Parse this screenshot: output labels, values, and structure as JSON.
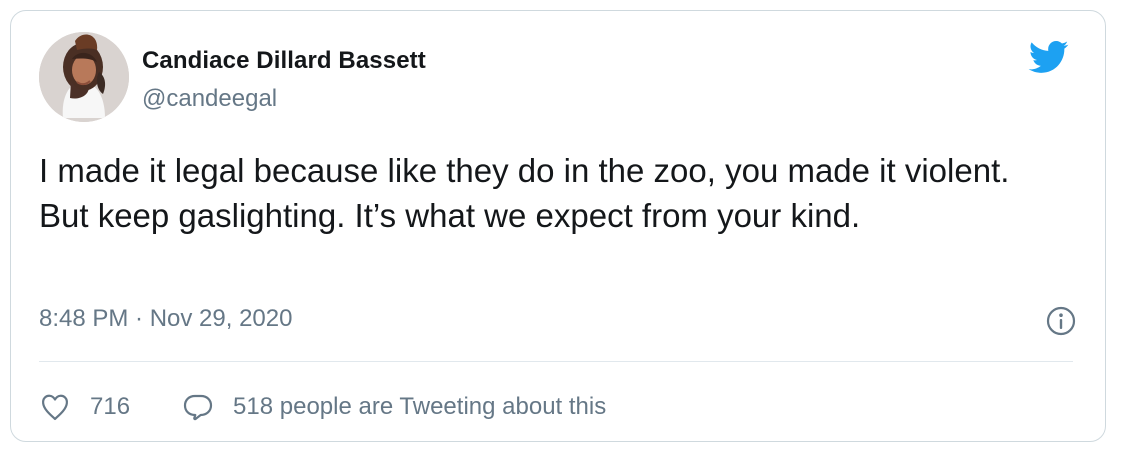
{
  "tweet": {
    "author": {
      "name": "Candiace Dillard Bassett",
      "handle": "@candeegal",
      "avatar_icon": "user-avatar"
    },
    "text": "I made it legal because like they do in the zoo, you made it violent. But keep gaslighting. It’s what we expect from your kind.",
    "timestamp": "8:48 PM · Nov 29, 2020",
    "likes": "716",
    "retweet_conversation": "518 people are Tweeting about this"
  },
  "icons": {
    "brand": "twitter-bird-icon",
    "info": "info-icon",
    "like": "heart-icon",
    "reply": "speech-bubble-icon"
  },
  "colors": {
    "brand": "#1da1f2",
    "text": "#14171a",
    "secondary": "#657786",
    "border": "#cfd9de",
    "divider": "#e1e8ed"
  }
}
